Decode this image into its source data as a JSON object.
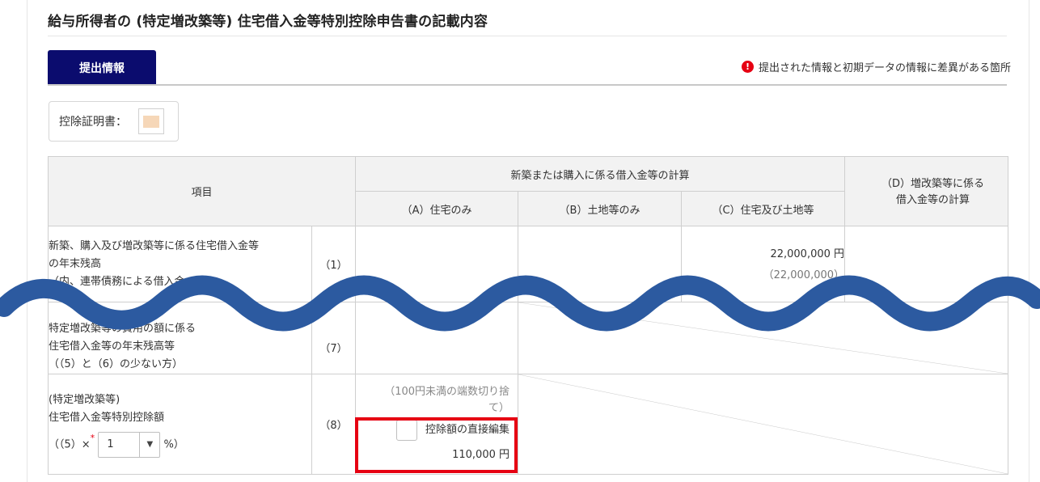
{
  "page_title": "給与所得者の (特定増改築等) 住宅借入金等特別控除申告書の記載内容",
  "tab_label": "提出情報",
  "diff_notice": "提出された情報と初期データの情報に差異がある箇所",
  "alert_glyph": "!",
  "certificate_label": "控除証明書：",
  "table": {
    "item_header": "項目",
    "group_header": "新築または購入に係る借入金等の計算",
    "col_a": "（A）住宅のみ",
    "col_b": "（B）土地等のみ",
    "col_c": "（C）住宅及び土地等",
    "col_d": "（D）増改築等に係る借入金等の計算",
    "row1": {
      "label_line1": "新築、購入及び増改築等に係る住宅借入金等",
      "label_line2": "の年末残高",
      "label_line3": "（内、連帯債務による借入金の額）",
      "no": "（1）",
      "c_value": "22,000,000 円",
      "c_sub": "（22,000,000）"
    },
    "row7": {
      "label_line1": "特定増改築等の費用の額に係る",
      "label_line2": "住宅借入金等の年末残高等",
      "label_line3": "（（5）と（6）の少ない方）",
      "no": "（7）"
    },
    "row8": {
      "label_line1": "(特定増改築等)",
      "label_line2": "住宅借入金等特別控除額",
      "formula_prefix": "（（5）×",
      "required_mark": "*",
      "rate_value": "1",
      "formula_suffix": "%）",
      "no": "（8）",
      "note": "（100円未満の端数切り捨て）",
      "checkbox_label": "控除額の直接編集",
      "amount": "110,000 円"
    }
  },
  "colors": {
    "tab": "#0b0c6e",
    "alert": "#e60012",
    "wave": "#2c5aa0"
  }
}
